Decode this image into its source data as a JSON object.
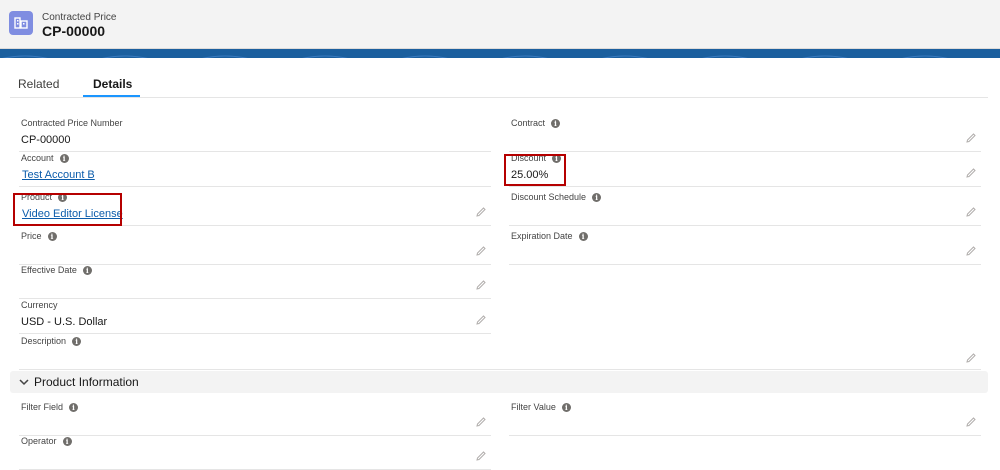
{
  "header": {
    "object_type": "Contracted Price",
    "record_name": "CP-00000",
    "icon": "contracted-price-icon",
    "icon_color": "#7f8de1"
  },
  "tabs": [
    {
      "label": "Related",
      "active": false
    },
    {
      "label": "Details",
      "active": true
    }
  ],
  "fields": {
    "contracted_price_number": {
      "label": "Contracted Price Number",
      "value": "CP-00000"
    },
    "account": {
      "label": "Account",
      "value": "Test Account B"
    },
    "product": {
      "label": "Product",
      "value": "Video Editor License"
    },
    "price": {
      "label": "Price",
      "value": ""
    },
    "effective_date": {
      "label": "Effective Date",
      "value": ""
    },
    "currency": {
      "label": "Currency",
      "value": "USD - U.S. Dollar"
    },
    "description": {
      "label": "Description",
      "value": ""
    },
    "contract": {
      "label": "Contract",
      "value": ""
    },
    "discount": {
      "label": "Discount",
      "value": "25.00%"
    },
    "discount_schedule": {
      "label": "Discount Schedule",
      "value": ""
    },
    "expiration_date": {
      "label": "Expiration Date",
      "value": ""
    },
    "filter_field": {
      "label": "Filter Field",
      "value": ""
    },
    "filter_value": {
      "label": "Filter Value",
      "value": ""
    },
    "operator": {
      "label": "Operator",
      "value": ""
    }
  },
  "section": {
    "title": "Product Information",
    "expanded": true
  },
  "colors": {
    "link": "#0b5cab",
    "highlight": "#b50000",
    "tab_accent": "#1b96ff",
    "band": "#1b5f9e"
  }
}
